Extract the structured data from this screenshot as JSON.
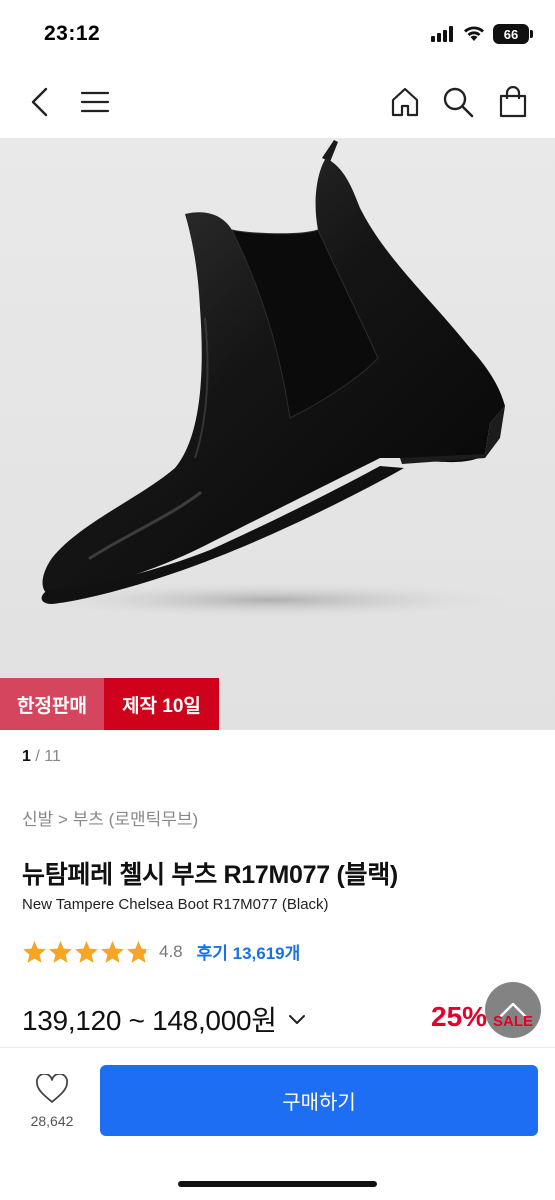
{
  "status": {
    "time": "23:12",
    "battery": "66",
    "icons": [
      "signal-icon",
      "wifi-icon",
      "battery-icon"
    ]
  },
  "nav": {
    "icons": [
      "back-icon",
      "menu-icon",
      "home-icon",
      "search-icon",
      "bag-icon"
    ]
  },
  "badges": {
    "limited": "한정판매",
    "production": "제작 10일"
  },
  "pager": {
    "current": "1",
    "separator": " / ",
    "total": "11"
  },
  "breadcrumb": "신발 > 부츠 (로맨틱무브)",
  "product": {
    "title": "뉴탐페레 첼시 부츠 R17M077 (블랙)",
    "subtitle": "New Tampere Chelsea Boot R17M077 (Black)",
    "rating": 4.8,
    "rating_text": "4.8",
    "reviews": "후기 13,619개",
    "price": "139,120 ~ 148,000원",
    "discount": "25%",
    "sale": "SALE"
  },
  "footer": {
    "wish_count": "28,642",
    "buy_label": "구매하기"
  },
  "colors": {
    "accent": "#1e6ef4",
    "sale": "#e4002b",
    "star": "#f5a623",
    "review": "#1971e6",
    "badge_limited": "#d6455e",
    "badge_production": "#d0021b"
  }
}
